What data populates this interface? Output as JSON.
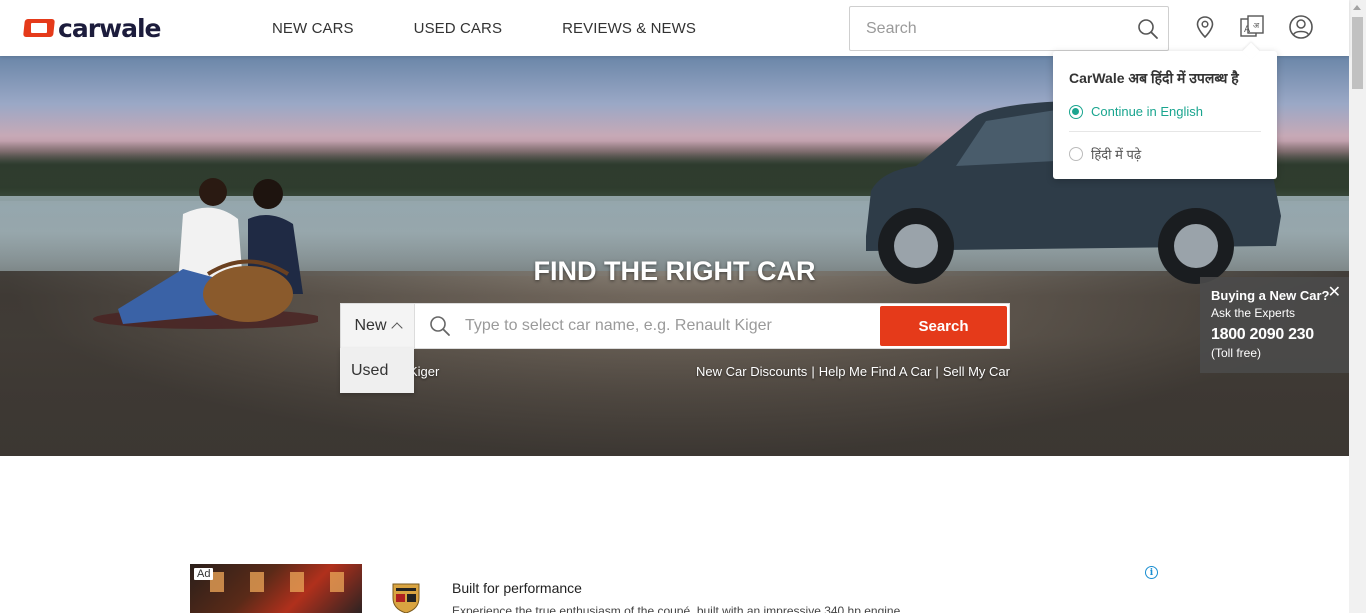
{
  "brand": {
    "name": "carwale",
    "accent": "#e53a1a"
  },
  "nav": {
    "items": [
      {
        "label": "NEW CARS"
      },
      {
        "label": "USED CARS"
      },
      {
        "label": "REVIEWS & NEWS"
      }
    ]
  },
  "header_search": {
    "placeholder": "Search",
    "icon": "search-icon"
  },
  "header_icons": [
    "location-pin-icon",
    "language-icon",
    "user-account-icon"
  ],
  "language_popup": {
    "title": "CarWale अब हिंदी में उपलब्ध है",
    "options": [
      {
        "label": "Continue in English",
        "selected": true
      },
      {
        "label": "हिंदी में पढ़े",
        "selected": false
      }
    ],
    "accent": "#1aa58f"
  },
  "hero": {
    "title": "FIND THE RIGHT CAR",
    "type_toggle": "New",
    "dropdown_option": "Used",
    "search_placeholder": "Type to select car name, e.g. Renault Kiger",
    "search_button": "Search",
    "trending_fragment": "Kiger",
    "quick_links": [
      "New Car Discounts",
      "Help Me Find A Car",
      "Sell My Car"
    ],
    "link_separator": "|"
  },
  "experts": {
    "heading": "Buying a New Car?",
    "subheading": "Ask the Experts",
    "phone": "1800 2090 230",
    "note": "(Toll free)",
    "close": "✕"
  },
  "ad": {
    "label": "Ad",
    "title": "Built for performance",
    "description": "Experience the true enthusiasm of the coupé, built with an impressive 340 hp engine.",
    "info": "i"
  }
}
